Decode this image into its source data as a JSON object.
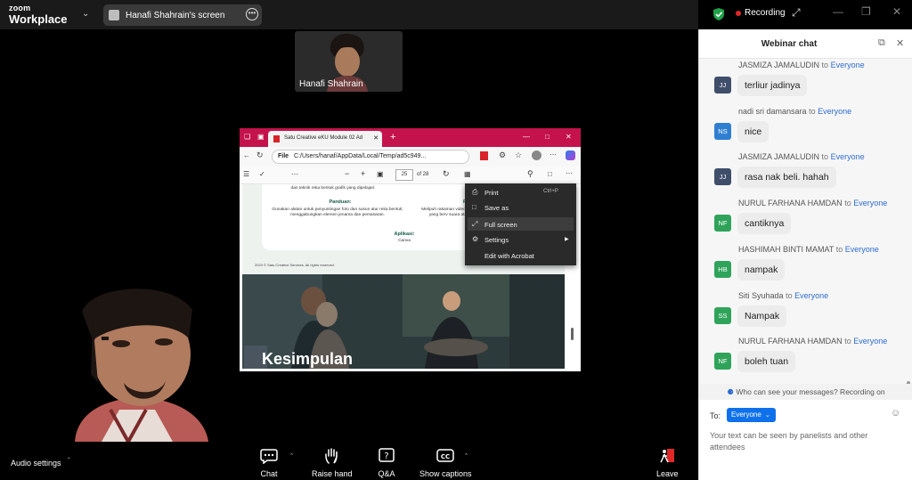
{
  "app": {
    "logo_line1": "zoom",
    "logo_line2": "Workplace"
  },
  "header": {
    "screen_share_label": "Hanafi Shahrain's screen",
    "recording_label": "Recording"
  },
  "participants": [
    {
      "name": "Hanafi Shahrain"
    }
  ],
  "shared_screen": {
    "tab_title": "Satu Creative eKU Module 02 Ad",
    "address_prefix": "File",
    "address": "C:/Users/hanaf/AppData/Local/Temp/ad5c949...",
    "page_current": "25",
    "page_total": "of 28",
    "slide": {
      "line_top": "dan teknik reka bentuk grafik yang dipelajari.",
      "panduan_heading": "Panduan:",
      "panduan_text": "Gunakan alatan untuk penyuntingan foto dan susun atur reka bentuk; menggabungkan elemen jenama dan pemasaran.",
      "panduan_heading_2": "Pan",
      "panduan_text_2": "Melipuh rakaman video, percenten yang berv suara atau muzi",
      "aplikasi_heading": "Aplikasi:",
      "aplikasi_value": "Canva",
      "footer": "2023 © Satu Creative Services. All rights reserved.",
      "slide2_title": "Kesimpulan"
    },
    "context_menu": [
      {
        "label": "Print",
        "shortcut": "Ctrl+P",
        "icon": "print-icon"
      },
      {
        "label": "Save as",
        "shortcut": "",
        "icon": "save-icon"
      },
      {
        "label": "Full screen",
        "shortcut": "",
        "icon": "fullscreen-icon"
      },
      {
        "label": "Settings",
        "shortcut": "",
        "icon": "settings-icon"
      },
      {
        "label": "Edit with Acrobat",
        "shortcut": "",
        "icon": ""
      }
    ]
  },
  "toolbar": {
    "audio_settings": "Audio settings",
    "chat": "Chat",
    "raise_hand": "Raise hand",
    "qa": "Q&A",
    "show_captions": "Show captions",
    "leave": "Leave"
  },
  "chat": {
    "title": "Webinar chat",
    "to_word": "to",
    "messages": [
      {
        "sender": "JASMIZA JAMALUDIN",
        "recipient": "Everyone",
        "initials": "JJ",
        "color": "#3f4f6b",
        "text": "terliur jadinya"
      },
      {
        "sender": "nadi sri damansara",
        "recipient": "Everyone",
        "initials": "NS",
        "color": "#2f7fd1",
        "text": "nice"
      },
      {
        "sender": "JASMIZA JAMALUDIN",
        "recipient": "Everyone",
        "initials": "JJ",
        "color": "#3f4f6b",
        "text": "rasa nak beli. hahah"
      },
      {
        "sender": "NURUL FARHANA HAMDAN",
        "recipient": "Everyone",
        "initials": "NF",
        "color": "#2fa35a",
        "text": "cantiknya"
      },
      {
        "sender": "HASHIMAH BINTI MAMAT",
        "recipient": "Everyone",
        "initials": "HB",
        "color": "#2fa35a",
        "text": "nampak"
      },
      {
        "sender": "Siti Syuhada",
        "recipient": "Everyone",
        "initials": "SS",
        "color": "#2fa35a",
        "text": "Nampak"
      },
      {
        "sender": "NURUL FARHANA HAMDAN",
        "recipient": "Everyone",
        "initials": "NF",
        "color": "#2fa35a",
        "text": "boleh tuan"
      }
    ],
    "who_can_see": "Who can see your messages? Recording on",
    "to_label": "To:",
    "recipient_selected": "Everyone",
    "input_placeholder": "Your text can be seen by panelists and other attendees"
  }
}
